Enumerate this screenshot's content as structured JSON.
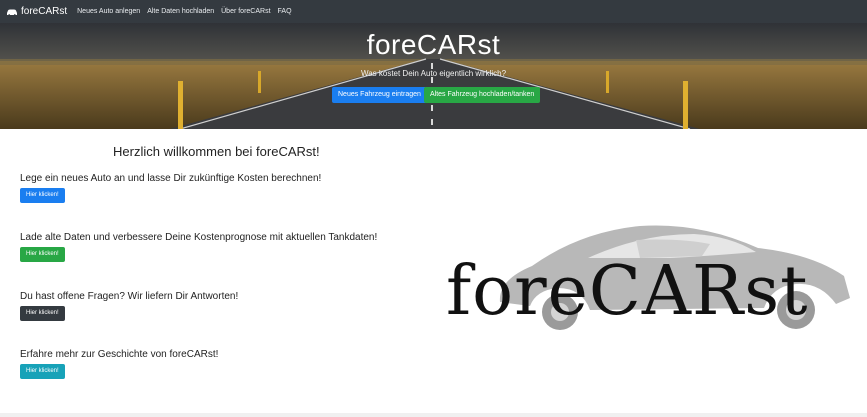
{
  "navbar": {
    "brand": "foreCARst",
    "links": [
      "Neues Auto anlegen",
      "Alte Daten hochladen",
      "Über foreCARst",
      "FAQ"
    ]
  },
  "hero": {
    "title": "foreCARst",
    "subtitle": "Was kostet Dein Auto eigentlich wirklich?",
    "primary_button": "Neues Fahrzeug eintragen",
    "secondary_button": "Altes Fahrzeug hochladen/tanken"
  },
  "main": {
    "welcome": "Herzlich willkommen bei foreCARst!",
    "rows": [
      {
        "text": "Lege ein neues Auto an und lasse Dir zukünftige Kosten berechnen!",
        "button": "Hier klicken!",
        "color": "#1a7ef0"
      },
      {
        "text": "Lade alte Daten und verbessere Deine Kostenprognose mit aktuellen Tankdaten!",
        "button": "Hier klicken!",
        "color": "#28a745"
      },
      {
        "text": "Du hast offene Fragen? Wir liefern Dir Antworten!",
        "button": "Hier klicken!",
        "color": "#343a40"
      },
      {
        "text": "Erfahre mehr zur Geschichte von foreCARst!",
        "button": "Hier klicken!",
        "color": "#17a2b8"
      }
    ]
  },
  "logo": {
    "text": "foreCARst",
    "icon": "car-silhouette-icon"
  }
}
